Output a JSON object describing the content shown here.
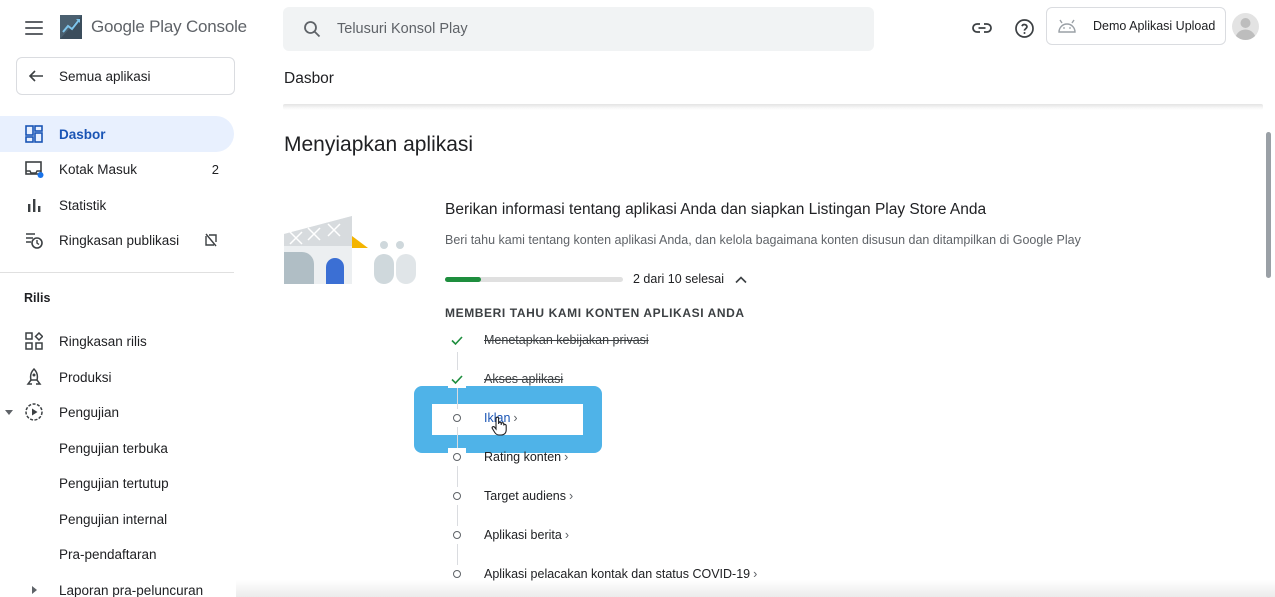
{
  "app": {
    "logo_prefix": "Google Play",
    "logo_suffix": "Console"
  },
  "sidebar": {
    "all_apps_label": "Semua aplikasi",
    "items": [
      {
        "label": "Dasbor",
        "icon": "dashboard-icon",
        "active": true
      },
      {
        "label": "Kotak Masuk",
        "icon": "inbox-icon",
        "count": "2"
      },
      {
        "label": "Statistik",
        "icon": "bar-chart-icon"
      },
      {
        "label": "Ringkasan publikasi",
        "icon": "publishing-overview-icon"
      }
    ],
    "release_section_title": "Rilis",
    "release_items": [
      {
        "label": "Ringkasan rilis",
        "icon": "releases-overview-icon"
      },
      {
        "label": "Produksi",
        "icon": "production-icon"
      },
      {
        "label": "Pengujian",
        "icon": "testing-icon",
        "expanded": true
      }
    ],
    "testing_sub_items": [
      {
        "label": "Pengujian terbuka"
      },
      {
        "label": "Pengujian tertutup"
      },
      {
        "label": "Pengujian internal"
      },
      {
        "label": "Pra-pendaftaran"
      },
      {
        "label": "Laporan pra-peluncuran"
      }
    ]
  },
  "header": {
    "search_placeholder": "Telusuri Konsol Play",
    "app_name": "Demo Aplikasi Upload",
    "page_title": "Dasbor"
  },
  "main": {
    "section_heading": "Menyiapkan aplikasi",
    "card_title": "Berikan informasi tentang aplikasi Anda dan siapkan Listingan Play Store Anda",
    "card_description": "Beri tahu kami tentang konten aplikasi Anda, dan kelola bagaimana konten disusun dan ditampilkan di Google Play",
    "progress_text": "2 dari 10 selesai",
    "progress_fraction": 0.2,
    "task_group_title": "MEMBERI TAHU KAMI KONTEN APLIKASI ANDA",
    "tasks": [
      {
        "label": "Menetapkan kebijakan privasi",
        "done": true
      },
      {
        "label": "Akses aplikasi",
        "done": true
      },
      {
        "label": "Iklan",
        "done": false,
        "highlighted": true
      },
      {
        "label": "Rating konten",
        "done": false
      },
      {
        "label": "Target audiens",
        "done": false
      },
      {
        "label": "Aplikasi berita",
        "done": false
      },
      {
        "label": "Aplikasi pelacakan kontak dan status COVID-19",
        "done": false
      }
    ]
  },
  "colors": {
    "accent_blue": "#1a55b5",
    "active_bg": "#e8f0fe",
    "progress_green": "#1e8e3e",
    "highlight_blue": "#4fb3e8"
  }
}
